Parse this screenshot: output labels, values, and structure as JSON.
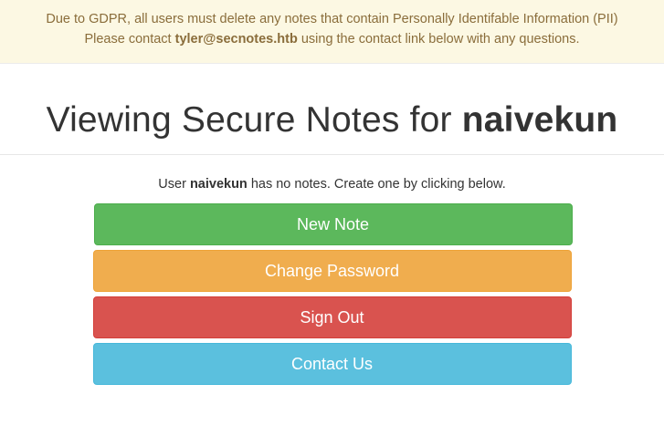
{
  "banner": {
    "line1": "Due to GDPR, all users must delete any notes that contain Personally Identifable Information (PII)",
    "line2_prefix": "Please contact ",
    "contact_email": "tyler@secnotes.htb",
    "line2_suffix": " using the contact link below with any questions."
  },
  "header": {
    "title_prefix": "Viewing Secure Notes for ",
    "username": "naivekun"
  },
  "status": {
    "prefix": "User ",
    "username": "naivekun",
    "suffix": " has no notes. Create one by clicking below."
  },
  "buttons": {
    "new_note": "New Note",
    "change_password": "Change Password",
    "sign_out": "Sign Out",
    "contact_us": "Contact Us"
  },
  "colors": {
    "success": "#5cb85c",
    "warning": "#f0ad4e",
    "danger": "#d9534f",
    "info": "#5bc0de",
    "banner_bg": "#fcf8e3",
    "banner_text": "#8a6d3b"
  }
}
